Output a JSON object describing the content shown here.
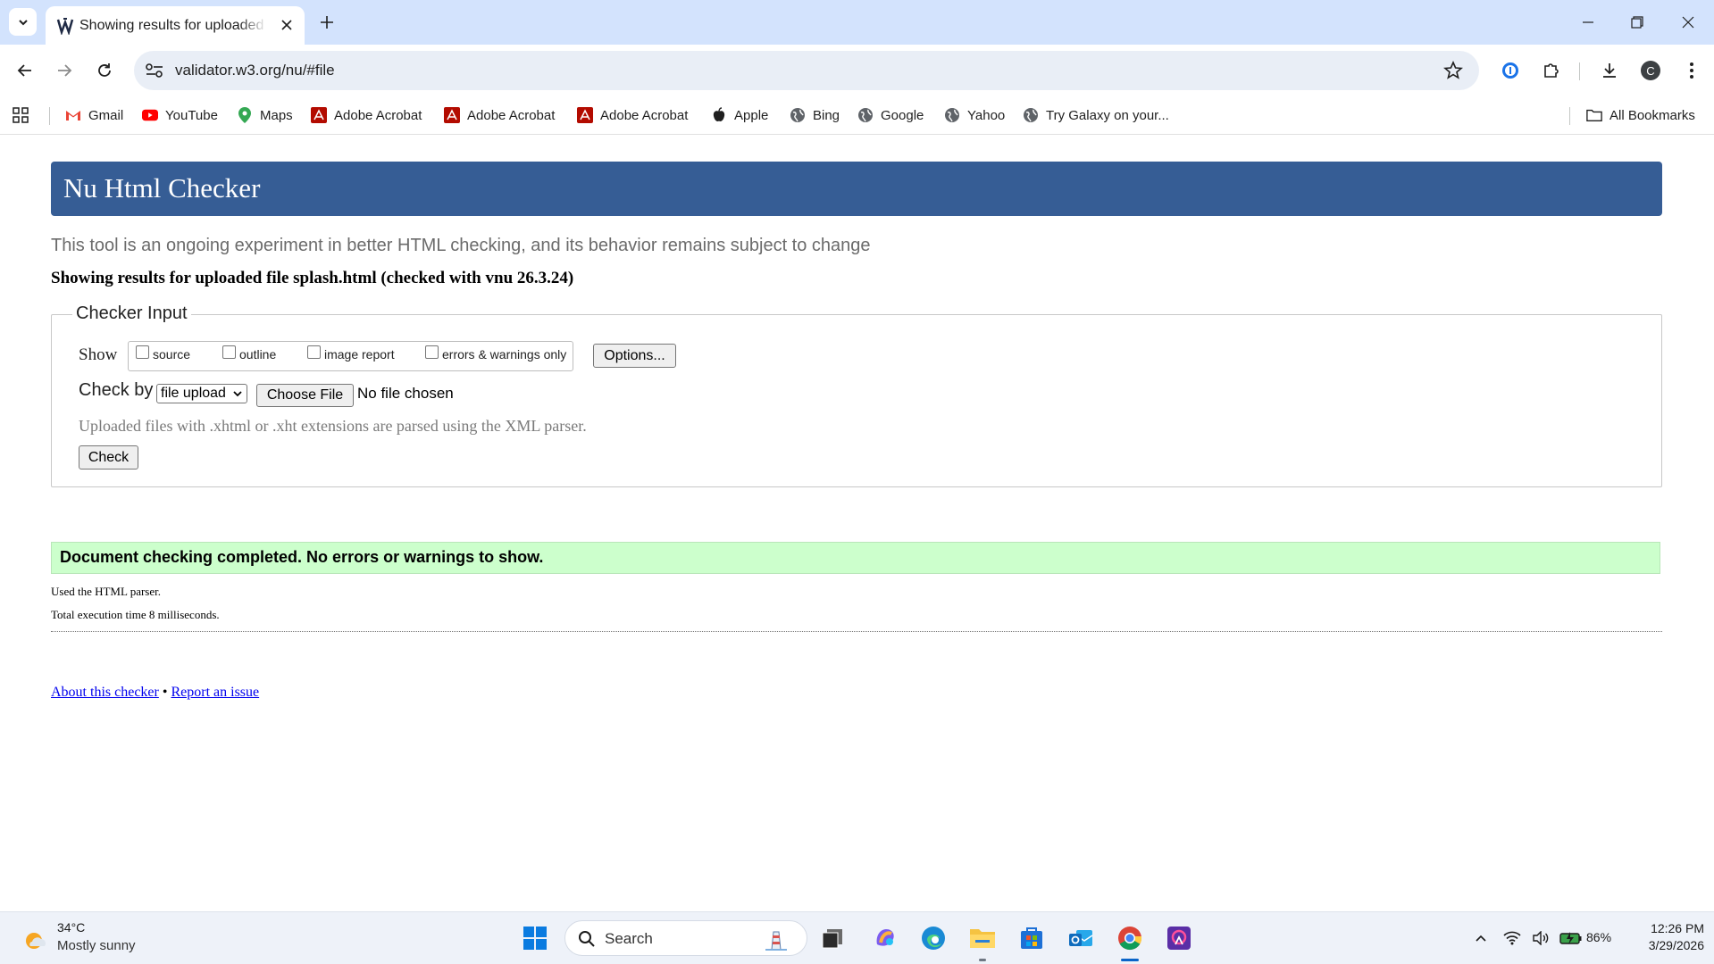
{
  "browser": {
    "tab_title": "Showing results for uploaded file splash.html",
    "url": "validator.w3.org/nu/#file",
    "profile_initial": "C",
    "bookmarks": [
      {
        "label": "Gmail",
        "icon": "gmail-icon"
      },
      {
        "label": "YouTube",
        "icon": "youtube-icon"
      },
      {
        "label": "Maps",
        "icon": "maps-icon"
      },
      {
        "label": "Adobe Acrobat",
        "icon": "acrobat-icon"
      },
      {
        "label": "Adobe Acrobat",
        "icon": "acrobat-icon"
      },
      {
        "label": "Adobe Acrobat",
        "icon": "acrobat-icon"
      },
      {
        "label": "Apple",
        "icon": "apple-icon"
      },
      {
        "label": "Bing",
        "icon": "globe-icon"
      },
      {
        "label": "Google",
        "icon": "globe-icon"
      },
      {
        "label": "Yahoo",
        "icon": "globe-icon"
      },
      {
        "label": "Try Galaxy on your...",
        "icon": "globe-icon"
      }
    ],
    "all_bookmarks": "All Bookmarks"
  },
  "page": {
    "title": "Nu Html Checker",
    "subtitle": "This tool is an ongoing experiment in better HTML checking, and its behavior remains subject to change",
    "results_heading": "Showing results for uploaded file splash.html (checked with vnu 26.3.24)",
    "checker_input": {
      "legend": "Checker Input",
      "show_label": "Show",
      "options": [
        {
          "label": "source",
          "checked": false
        },
        {
          "label": "outline",
          "checked": false
        },
        {
          "label": "image report",
          "checked": false
        },
        {
          "label": "errors & warnings only",
          "checked": false
        }
      ],
      "options_button": "Options...",
      "check_by_label": "Check by",
      "check_by_value": "file upload",
      "choose_file_button": "Choose File",
      "no_file_text": "No file chosen",
      "help_text": "Uploaded files with .xhtml or .xht extensions are parsed using the XML parser.",
      "check_button": "Check"
    },
    "success_message": "Document checking completed. No errors or warnings to show.",
    "parser_note": "Used the HTML parser.",
    "execution_time": "Total execution time 8 milliseconds.",
    "footer": {
      "about_link": "About this checker",
      "separator": "•",
      "report_link": "Report an issue"
    },
    "colors": {
      "title_bar": "#365d95",
      "success_bg": "#ccffcc",
      "link": "#0000ee"
    }
  },
  "taskbar": {
    "weather_temp": "34°C",
    "weather_desc": "Mostly sunny",
    "search_placeholder": "Search",
    "battery": "86%",
    "time": "12:26 PM",
    "date": "3/29/2026"
  }
}
